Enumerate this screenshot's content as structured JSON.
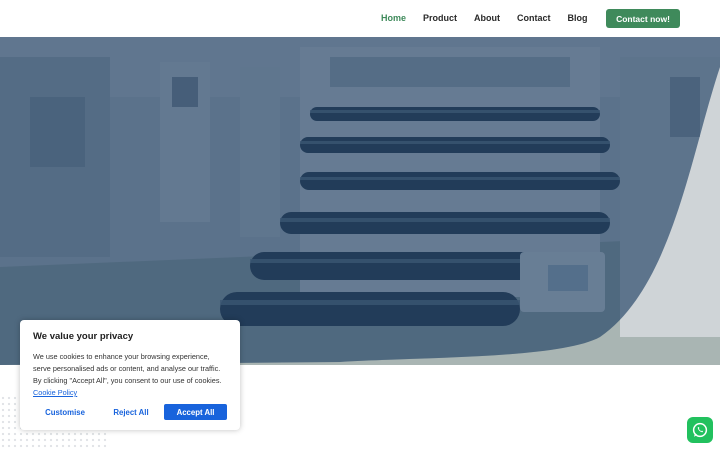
{
  "header": {
    "nav": [
      {
        "label": "Home",
        "active": true
      },
      {
        "label": "Product",
        "active": false
      },
      {
        "label": "About",
        "active": false
      },
      {
        "label": "Contact",
        "active": false
      },
      {
        "label": "Blog",
        "active": false
      }
    ],
    "cta_label": "Contact now!"
  },
  "hero": {
    "image_icon": "factory-machine-photo",
    "overlay_color": "#1c3a5e"
  },
  "cookie": {
    "title": "We value your privacy",
    "text": "We use cookies to enhance your browsing experience, serve personalised ads or content, and analyse our traffic. By clicking \"Accept All\", you consent to our use of cookies.",
    "policy_link": "Cookie Policy",
    "customise_label": "Customise",
    "reject_label": "Reject All",
    "accept_label": "Accept All"
  },
  "whatsapp": {
    "icon": "whatsapp-icon"
  },
  "colors": {
    "brand_green": "#3f8a5b",
    "cookie_blue": "#1863dc",
    "whatsapp_green": "#22c15e"
  }
}
